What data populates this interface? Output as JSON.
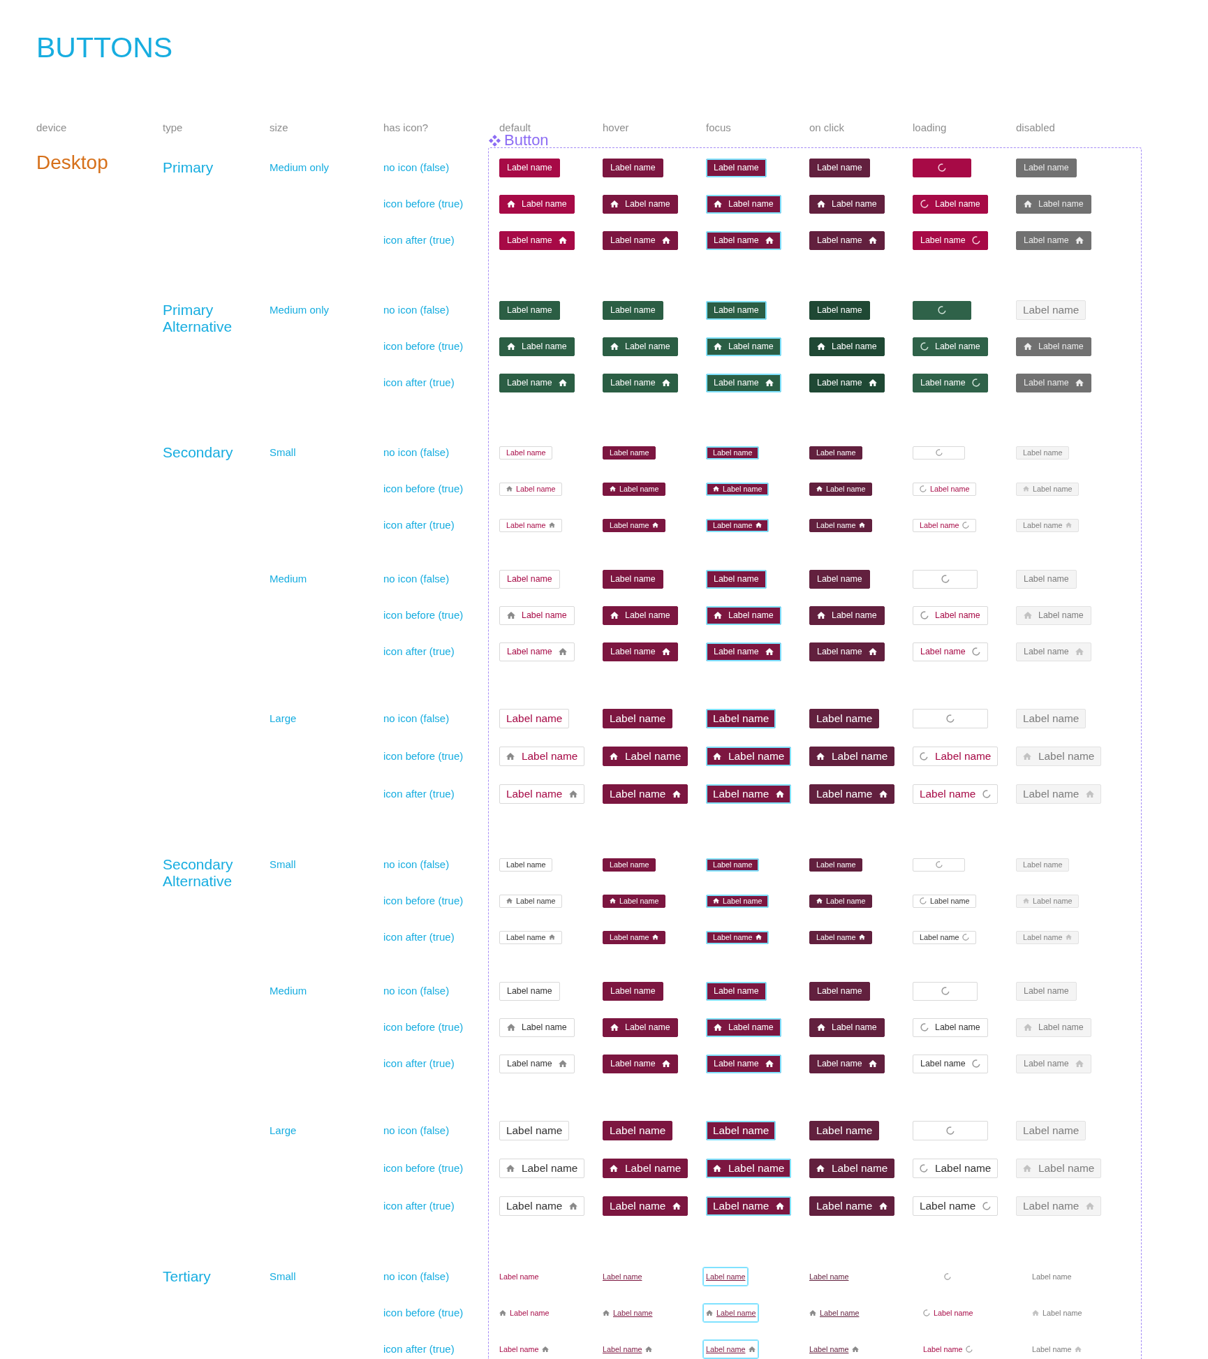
{
  "title": "BUTTONS",
  "columns": [
    "device",
    "type",
    "size",
    "has icon?",
    "default",
    "hover",
    "focus",
    "on click",
    "loading",
    "disabled"
  ],
  "component": {
    "name": "Button"
  },
  "device": "Desktop",
  "groups": [
    {
      "type": "Primary",
      "kind": "primary",
      "sizes": [
        {
          "size": "Medium only",
          "kind": "medium",
          "rows": [
            {
              "label": "no icon (false)",
              "kind": "no_icon",
              "buttons": [
                {
                  "kind": "default",
                  "label": "Label name"
                },
                {
                  "kind": "hover",
                  "label": "Label name"
                },
                {
                  "kind": "focus",
                  "label": "Label name"
                },
                {
                  "kind": "click",
                  "label": "Label name"
                },
                {
                  "kind": "loading"
                },
                {
                  "kind": "disabled",
                  "label": "Label name"
                }
              ]
            },
            {
              "label": "icon before (true)",
              "kind": "icon_before",
              "buttons": [
                {
                  "kind": "default",
                  "label": "Label name"
                },
                {
                  "kind": "hover",
                  "label": "Label name"
                },
                {
                  "kind": "focus",
                  "label": "Label name"
                },
                {
                  "kind": "click",
                  "label": "Label name"
                },
                {
                  "kind": "loading",
                  "label": "Label name"
                },
                {
                  "kind": "disabled",
                  "label": "Label name"
                }
              ]
            },
            {
              "label": "icon after (true)",
              "kind": "icon_after",
              "buttons": [
                {
                  "kind": "default",
                  "label": "Label name"
                },
                {
                  "kind": "hover",
                  "label": "Label name"
                },
                {
                  "kind": "focus",
                  "label": "Label name"
                },
                {
                  "kind": "click",
                  "label": "Label name"
                },
                {
                  "kind": "loading",
                  "label": "Label name"
                },
                {
                  "kind": "disabled",
                  "label": "Label name"
                }
              ]
            }
          ]
        }
      ]
    },
    {
      "type": "Primary Alternative",
      "kind": "primary_alt",
      "sizes": [
        {
          "size": "Medium only",
          "kind": "medium",
          "rows": [
            {
              "label": "no icon (false)",
              "kind": "no_icon",
              "buttons": [
                {
                  "kind": "default",
                  "label": "Label name"
                },
                {
                  "kind": "hover",
                  "label": "Label name"
                },
                {
                  "kind": "focus",
                  "label": "Label name"
                },
                {
                  "kind": "click",
                  "label": "Label name"
                },
                {
                  "kind": "loading"
                },
                {
                  "kind": "disabled_outlined",
                  "label": "Label name"
                }
              ]
            },
            {
              "label": "icon before (true)",
              "kind": "icon_before",
              "buttons": [
                {
                  "kind": "default",
                  "label": "Label name"
                },
                {
                  "kind": "hover",
                  "label": "Label name"
                },
                {
                  "kind": "focus",
                  "label": "Label name"
                },
                {
                  "kind": "click",
                  "label": "Label name"
                },
                {
                  "kind": "loading",
                  "label": "Label name"
                },
                {
                  "kind": "disabled",
                  "label": "Label name"
                }
              ]
            },
            {
              "label": "icon after (true)",
              "kind": "icon_after",
              "buttons": [
                {
                  "kind": "default",
                  "label": "Label name"
                },
                {
                  "kind": "hover",
                  "label": "Label name"
                },
                {
                  "kind": "focus",
                  "label": "Label name"
                },
                {
                  "kind": "click",
                  "label": "Label name"
                },
                {
                  "kind": "loading",
                  "label": "Label name"
                },
                {
                  "kind": "disabled",
                  "label": "Label name"
                }
              ]
            }
          ]
        }
      ]
    },
    {
      "type": "Secondary",
      "kind": "secondary",
      "sizes": [
        {
          "size": "Small",
          "kind": "small",
          "rows": [
            {
              "label": "no icon (false)",
              "kind": "no_icon",
              "buttons": [
                {
                  "kind": "default",
                  "label": "Label name"
                },
                {
                  "kind": "hover",
                  "label": "Label name"
                },
                {
                  "kind": "focus",
                  "label": "Label name"
                },
                {
                  "kind": "click",
                  "label": "Label name"
                },
                {
                  "kind": "loading"
                },
                {
                  "kind": "disabled",
                  "label": "Label name"
                }
              ]
            },
            {
              "label": "icon before (true)",
              "kind": "icon_before",
              "buttons": [
                {
                  "kind": "default",
                  "label": "Label name"
                },
                {
                  "kind": "hover",
                  "label": "Label name"
                },
                {
                  "kind": "focus",
                  "label": "Label name"
                },
                {
                  "kind": "click",
                  "label": "Label name"
                },
                {
                  "kind": "loading",
                  "label": "Label name"
                },
                {
                  "kind": "disabled",
                  "label": "Label name"
                }
              ]
            },
            {
              "label": "icon after (true)",
              "kind": "icon_after",
              "buttons": [
                {
                  "kind": "default",
                  "label": "Label name"
                },
                {
                  "kind": "hover",
                  "label": "Label name"
                },
                {
                  "kind": "focus",
                  "label": "Label name"
                },
                {
                  "kind": "click",
                  "label": "Label name"
                },
                {
                  "kind": "loading",
                  "label": "Label name"
                },
                {
                  "kind": "disabled",
                  "label": "Label name"
                }
              ]
            }
          ]
        },
        {
          "size": "Medium",
          "kind": "medium",
          "rows": [
            {
              "label": "no icon (false)",
              "kind": "no_icon",
              "buttons": [
                {
                  "kind": "default",
                  "label": "Label name"
                },
                {
                  "kind": "hover",
                  "label": "Label name"
                },
                {
                  "kind": "focus",
                  "label": "Label name"
                },
                {
                  "kind": "click",
                  "label": "Label name"
                },
                {
                  "kind": "loading"
                },
                {
                  "kind": "disabled",
                  "label": "Label name"
                }
              ]
            },
            {
              "label": "icon before (true)",
              "kind": "icon_before",
              "buttons": [
                {
                  "kind": "default",
                  "label": "Label name"
                },
                {
                  "kind": "hover",
                  "label": "Label name"
                },
                {
                  "kind": "focus",
                  "label": "Label name"
                },
                {
                  "kind": "click",
                  "label": "Label name"
                },
                {
                  "kind": "loading",
                  "label": "Label name"
                },
                {
                  "kind": "disabled",
                  "label": "Label name"
                }
              ]
            },
            {
              "label": "icon after (true)",
              "kind": "icon_after",
              "buttons": [
                {
                  "kind": "default",
                  "label": "Label name"
                },
                {
                  "kind": "hover",
                  "label": "Label name"
                },
                {
                  "kind": "focus",
                  "label": "Label name"
                },
                {
                  "kind": "click",
                  "label": "Label name"
                },
                {
                  "kind": "loading",
                  "label": "Label name"
                },
                {
                  "kind": "disabled",
                  "label": "Label name"
                }
              ]
            }
          ]
        },
        {
          "size": "Large",
          "kind": "large",
          "rows": [
            {
              "label": "no icon (false)",
              "kind": "no_icon",
              "buttons": [
                {
                  "kind": "default",
                  "label": "Label name"
                },
                {
                  "kind": "hover",
                  "label": "Label name"
                },
                {
                  "kind": "focus",
                  "label": "Label name"
                },
                {
                  "kind": "click",
                  "label": "Label name"
                },
                {
                  "kind": "loading"
                },
                {
                  "kind": "disabled",
                  "label": "Label name"
                }
              ]
            },
            {
              "label": "icon before (true)",
              "kind": "icon_before",
              "buttons": [
                {
                  "kind": "default",
                  "label": "Label name"
                },
                {
                  "kind": "hover",
                  "label": "Label name"
                },
                {
                  "kind": "focus",
                  "label": "Label name"
                },
                {
                  "kind": "click",
                  "label": "Label name"
                },
                {
                  "kind": "loading",
                  "label": "Label name"
                },
                {
                  "kind": "disabled",
                  "label": "Label name"
                }
              ]
            },
            {
              "label": "icon after (true)",
              "kind": "icon_after",
              "buttons": [
                {
                  "kind": "default",
                  "label": "Label name"
                },
                {
                  "kind": "hover",
                  "label": "Label name"
                },
                {
                  "kind": "focus",
                  "label": "Label name"
                },
                {
                  "kind": "click",
                  "label": "Label name"
                },
                {
                  "kind": "loading",
                  "label": "Label name"
                },
                {
                  "kind": "disabled",
                  "label": "Label name"
                }
              ]
            }
          ]
        }
      ]
    },
    {
      "type": "Secondary Alternative",
      "kind": "secondary_alt",
      "sizes": [
        {
          "size": "Small",
          "kind": "small",
          "rows": [
            {
              "label": "no icon (false)",
              "kind": "no_icon",
              "buttons": [
                {
                  "kind": "default",
                  "label": "Label name"
                },
                {
                  "kind": "hover",
                  "label": "Label name"
                },
                {
                  "kind": "focus",
                  "label": "Label name"
                },
                {
                  "kind": "click",
                  "label": "Label name"
                },
                {
                  "kind": "loading"
                },
                {
                  "kind": "disabled",
                  "label": "Label name"
                }
              ]
            },
            {
              "label": "icon before (true)",
              "kind": "icon_before",
              "buttons": [
                {
                  "kind": "default",
                  "label": "Label name"
                },
                {
                  "kind": "hover",
                  "label": "Label name"
                },
                {
                  "kind": "focus",
                  "label": "Label name"
                },
                {
                  "kind": "click",
                  "label": "Label name"
                },
                {
                  "kind": "loading",
                  "label": "Label name"
                },
                {
                  "kind": "disabled",
                  "label": "Label name"
                }
              ]
            },
            {
              "label": "icon after (true)",
              "kind": "icon_after",
              "buttons": [
                {
                  "kind": "default",
                  "label": "Label name"
                },
                {
                  "kind": "hover",
                  "label": "Label name"
                },
                {
                  "kind": "focus",
                  "label": "Label name"
                },
                {
                  "kind": "click",
                  "label": "Label name"
                },
                {
                  "kind": "loading",
                  "label": "Label name"
                },
                {
                  "kind": "disabled",
                  "label": "Label name"
                }
              ]
            }
          ]
        },
        {
          "size": "Medium",
          "kind": "medium",
          "rows": [
            {
              "label": "no icon (false)",
              "kind": "no_icon",
              "buttons": [
                {
                  "kind": "default",
                  "label": "Label name"
                },
                {
                  "kind": "hover",
                  "label": "Label name"
                },
                {
                  "kind": "focus",
                  "label": "Label name"
                },
                {
                  "kind": "click",
                  "label": "Label name"
                },
                {
                  "kind": "loading"
                },
                {
                  "kind": "disabled",
                  "label": "Label name"
                }
              ]
            },
            {
              "label": "icon before (true)",
              "kind": "icon_before",
              "buttons": [
                {
                  "kind": "default",
                  "label": "Label name"
                },
                {
                  "kind": "hover",
                  "label": "Label name"
                },
                {
                  "kind": "focus",
                  "label": "Label name"
                },
                {
                  "kind": "click",
                  "label": "Label name"
                },
                {
                  "kind": "loading",
                  "label": "Label name"
                },
                {
                  "kind": "disabled",
                  "label": "Label name"
                }
              ]
            },
            {
              "label": "icon after (true)",
              "kind": "icon_after",
              "buttons": [
                {
                  "kind": "default",
                  "label": "Label name"
                },
                {
                  "kind": "hover",
                  "label": "Label name"
                },
                {
                  "kind": "focus",
                  "label": "Label name"
                },
                {
                  "kind": "click",
                  "label": "Label name"
                },
                {
                  "kind": "loading",
                  "label": "Label name"
                },
                {
                  "kind": "disabled",
                  "label": "Label name"
                }
              ]
            }
          ]
        },
        {
          "size": "Large",
          "kind": "large",
          "rows": [
            {
              "label": "no icon (false)",
              "kind": "no_icon",
              "buttons": [
                {
                  "kind": "default",
                  "label": "Label name"
                },
                {
                  "kind": "hover",
                  "label": "Label name"
                },
                {
                  "kind": "focus",
                  "label": "Label name"
                },
                {
                  "kind": "click",
                  "label": "Label name"
                },
                {
                  "kind": "loading"
                },
                {
                  "kind": "disabled",
                  "label": "Label name"
                }
              ]
            },
            {
              "label": "icon before (true)",
              "kind": "icon_before",
              "buttons": [
                {
                  "kind": "default",
                  "label": "Label name"
                },
                {
                  "kind": "hover",
                  "label": "Label name"
                },
                {
                  "kind": "focus",
                  "label": "Label name"
                },
                {
                  "kind": "click",
                  "label": "Label name"
                },
                {
                  "kind": "loading",
                  "label": "Label name"
                },
                {
                  "kind": "disabled",
                  "label": "Label name"
                }
              ]
            },
            {
              "label": "icon after (true)",
              "kind": "icon_after",
              "buttons": [
                {
                  "kind": "default",
                  "label": "Label name"
                },
                {
                  "kind": "hover",
                  "label": "Label name"
                },
                {
                  "kind": "focus",
                  "label": "Label name"
                },
                {
                  "kind": "click",
                  "label": "Label name"
                },
                {
                  "kind": "loading",
                  "label": "Label name"
                },
                {
                  "kind": "disabled",
                  "label": "Label name"
                }
              ]
            }
          ]
        }
      ]
    },
    {
      "type": "Tertiary",
      "kind": "tertiary",
      "sizes": [
        {
          "size": "Small",
          "kind": "small",
          "rows": [
            {
              "label": "no icon (false)",
              "kind": "no_icon",
              "buttons": [
                {
                  "kind": "default",
                  "label": "Label name"
                },
                {
                  "kind": "hover",
                  "label": "Label name"
                },
                {
                  "kind": "focus",
                  "label": "Label name"
                },
                {
                  "kind": "click",
                  "label": "Label name"
                },
                {
                  "kind": "loading"
                },
                {
                  "kind": "disabled",
                  "label": "Label name"
                }
              ]
            },
            {
              "label": "icon before (true)",
              "kind": "icon_before",
              "buttons": [
                {
                  "kind": "default",
                  "label": "Label name"
                },
                {
                  "kind": "hover",
                  "label": "Label name"
                },
                {
                  "kind": "focus",
                  "label": "Label name"
                },
                {
                  "kind": "click",
                  "label": "Label name"
                },
                {
                  "kind": "loading",
                  "label": "Label name"
                },
                {
                  "kind": "disabled",
                  "label": "Label name"
                }
              ]
            },
            {
              "label": "icon after (true)",
              "kind": "icon_after",
              "buttons": [
                {
                  "kind": "default",
                  "label": "Label name"
                },
                {
                  "kind": "hover",
                  "label": "Label name"
                },
                {
                  "kind": "focus",
                  "label": "Label name"
                },
                {
                  "kind": "click",
                  "label": "Label name"
                },
                {
                  "kind": "loading",
                  "label": "Label name"
                },
                {
                  "kind": "disabled",
                  "label": "Label name"
                }
              ]
            }
          ]
        }
      ]
    }
  ]
}
